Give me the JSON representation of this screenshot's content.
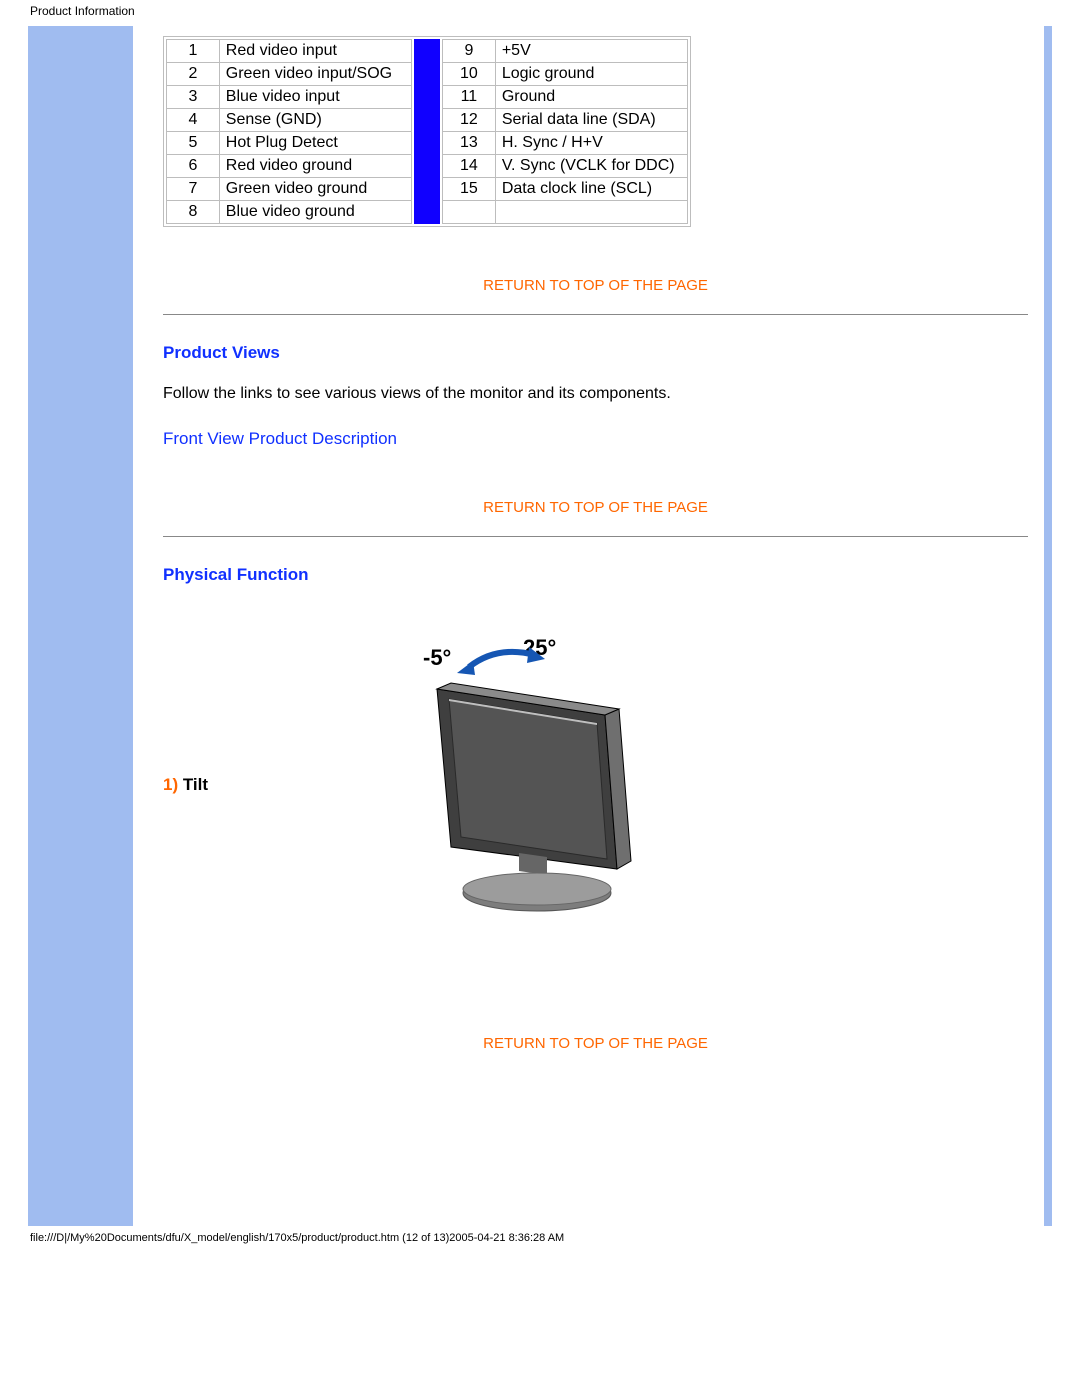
{
  "header": "Product Information",
  "pins": {
    "left": [
      {
        "n": "1",
        "d": "Red video input"
      },
      {
        "n": "2",
        "d": "Green video input/SOG"
      },
      {
        "n": "3",
        "d": "Blue video input"
      },
      {
        "n": "4",
        "d": "Sense (GND)"
      },
      {
        "n": "5",
        "d": "Hot Plug Detect"
      },
      {
        "n": "6",
        "d": "Red video ground"
      },
      {
        "n": "7",
        "d": "Green video ground"
      },
      {
        "n": "8",
        "d": "Blue video ground"
      }
    ],
    "right": [
      {
        "n": "9",
        "d": "+5V"
      },
      {
        "n": "10",
        "d": "Logic ground"
      },
      {
        "n": "11",
        "d": "Ground"
      },
      {
        "n": "12",
        "d": "Serial data line (SDA)"
      },
      {
        "n": "13",
        "d": "H. Sync / H+V"
      },
      {
        "n": "14",
        "d": "V. Sync (VCLK for DDC)"
      },
      {
        "n": "15",
        "d": "Data clock line (SCL)"
      }
    ]
  },
  "links": {
    "return": "RETURN TO TOP OF THE PAGE",
    "front_view": "Front View Product Description"
  },
  "sections": {
    "product_views": {
      "heading": "Product Views",
      "body": "Follow the links to see various views of the monitor and its components."
    },
    "physical_function": {
      "heading": "Physical Function",
      "tilt_num": "1)",
      "tilt_label": " Tilt",
      "angle_neg": "-5°",
      "angle_pos": "25°"
    }
  },
  "footer": "file:///D|/My%20Documents/dfu/X_model/english/170x5/product/product.htm (12 of 13)2005-04-21 8:36:28 AM"
}
